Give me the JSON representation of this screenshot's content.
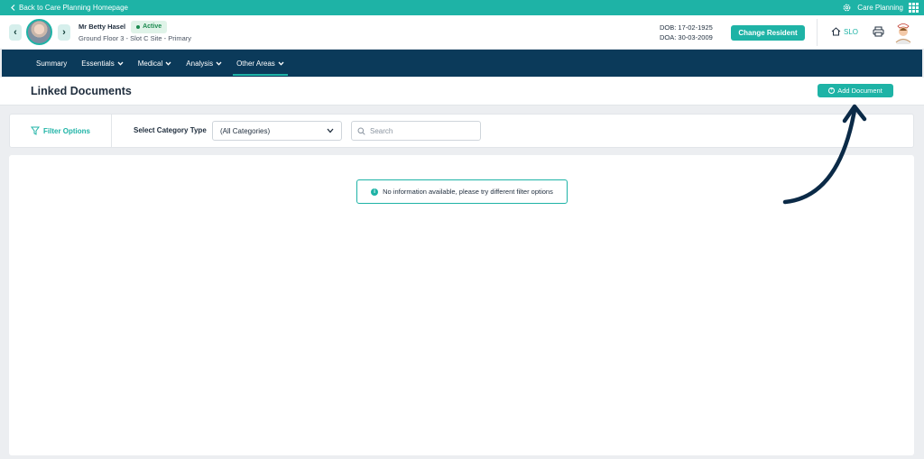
{
  "topbar": {
    "back_label": "Back to Care Planning Homepage",
    "module_label": "Care Planning"
  },
  "resident": {
    "name": "Mr Betty Hasel",
    "status": "Active",
    "location": "Ground Floor 3 - Slot C Site - Primary",
    "dob": "DOB: 17-02-1925",
    "doa": "DOA: 30-03-2009",
    "change_label": "Change Resident",
    "home_code": "SLO"
  },
  "nav": {
    "items": [
      {
        "label": "Summary"
      },
      {
        "label": "Essentials"
      },
      {
        "label": "Medical"
      },
      {
        "label": "Analysis"
      },
      {
        "label": "Other Areas"
      }
    ],
    "active": "Other Areas"
  },
  "page": {
    "title": "Linked Documents",
    "add_label": "Add Document"
  },
  "filters": {
    "toggle_label": "Filter Options",
    "category_label": "Select Category Type",
    "category_value": "(All Categories)",
    "search_placeholder": "Search"
  },
  "empty": {
    "message": "No information available, please try different filter options"
  },
  "colors": {
    "accent": "#1eb3a6",
    "nav_bg": "#0b3a5a",
    "annotation": "#0b2a47"
  }
}
